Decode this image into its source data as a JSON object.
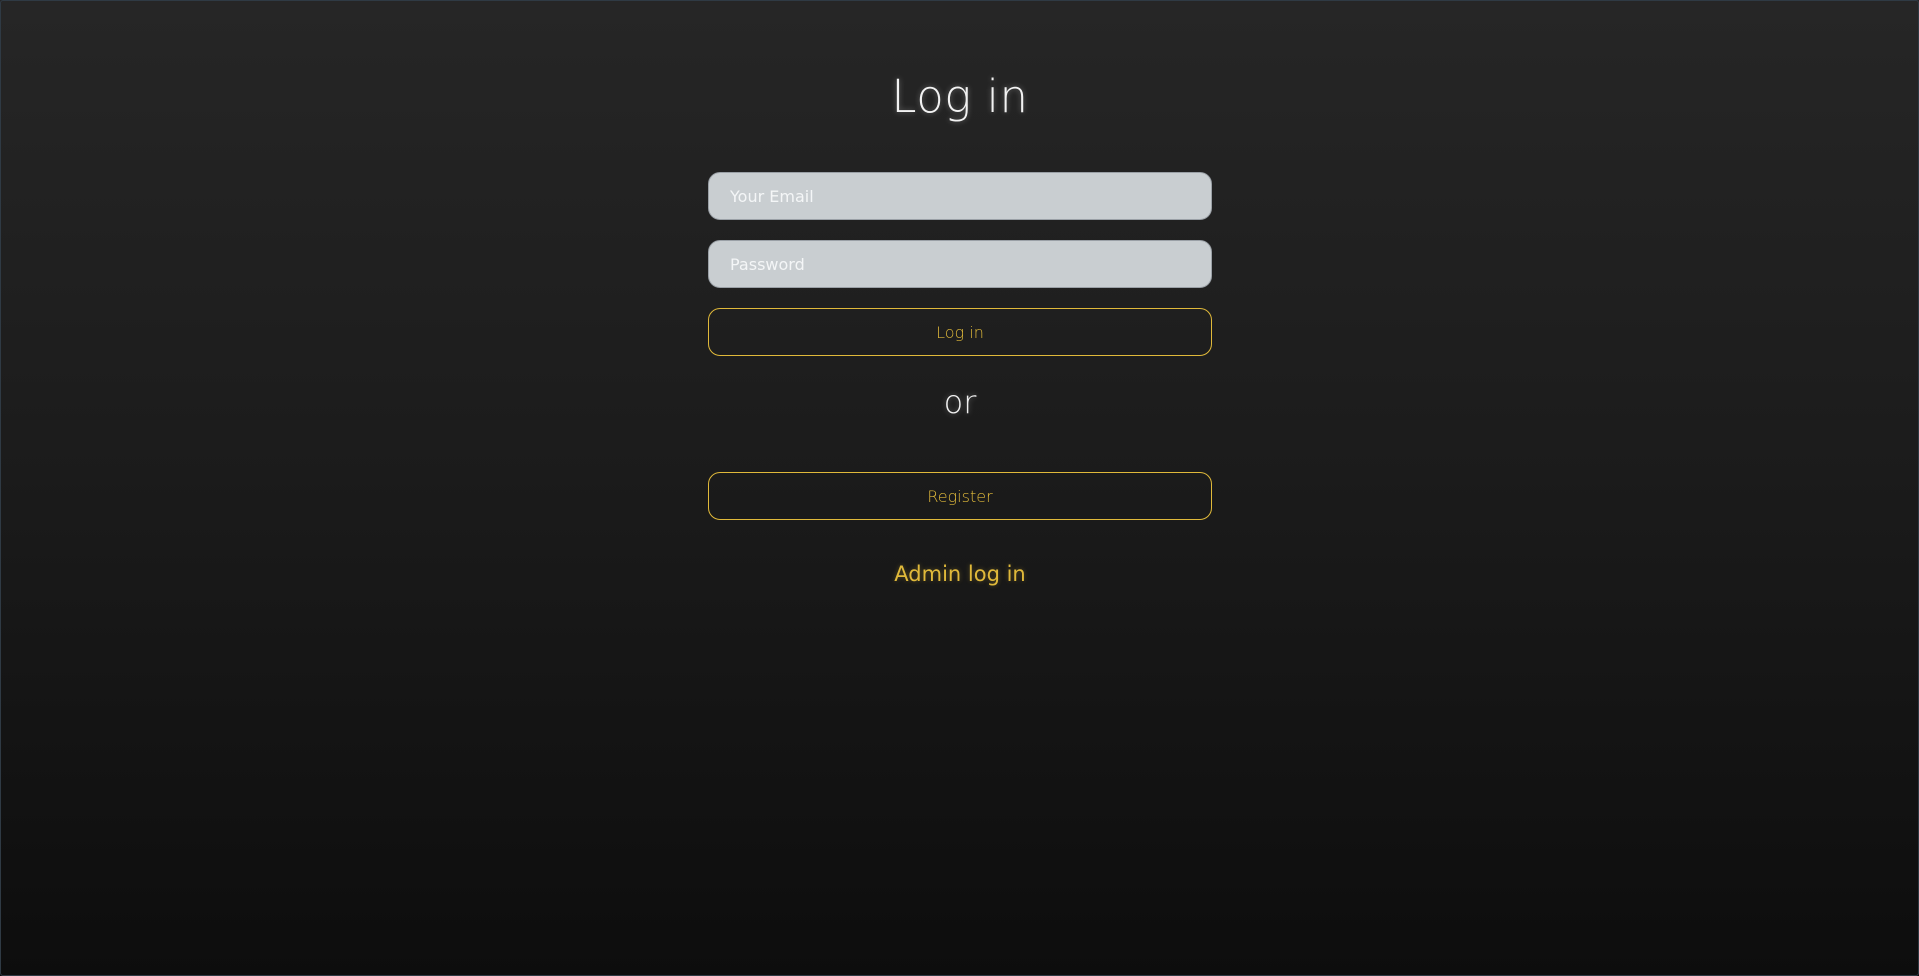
{
  "login": {
    "title": "Log in",
    "email_placeholder": "Your Email",
    "password_placeholder": "Password",
    "login_button": "Log in",
    "or_text": "or",
    "register_button": "Register",
    "admin_link": "Admin log in"
  },
  "colors": {
    "accent": "#e0b93a",
    "field_bg": "#c9ced1",
    "background_top": "#262626",
    "background_bottom": "#0d0d0d"
  }
}
